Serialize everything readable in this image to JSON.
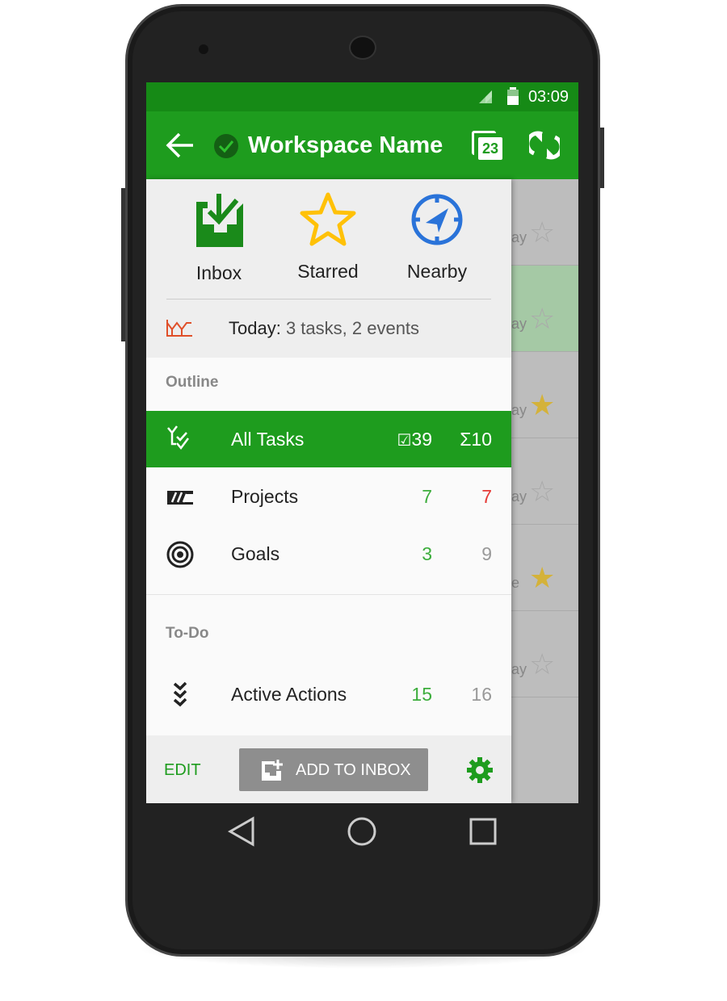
{
  "status_bar": {
    "time": "03:09"
  },
  "app_bar": {
    "title": "Workspace Name",
    "calendar_day": "23"
  },
  "quick_access": [
    {
      "label": "Inbox",
      "icon": "inbox-download-icon",
      "color": "#1a8a1a"
    },
    {
      "label": "Starred",
      "icon": "star-outline-icon",
      "color": "#ffc107"
    },
    {
      "label": "Nearby",
      "icon": "compass-icon",
      "color": "#2a73d9"
    }
  ],
  "today": {
    "label": "Today:",
    "summary": "3 tasks, 2 events"
  },
  "outline": {
    "header": "Outline",
    "items": [
      {
        "label": "All Tasks",
        "count1": "39",
        "count2": "10",
        "selected": true
      },
      {
        "label": "Projects",
        "count1": "7",
        "count2": "7"
      },
      {
        "label": "Goals",
        "count1": "3",
        "count2": "9"
      }
    ]
  },
  "todo": {
    "header": "To-Do",
    "items": [
      {
        "label": "Active Actions",
        "count1": "15",
        "count2": "16"
      }
    ]
  },
  "bottom": {
    "edit": "EDIT",
    "add_to_inbox": "ADD TO INBOX"
  },
  "background_list": [
    {
      "frag": "ay",
      "starred": false
    },
    {
      "frag": "ay",
      "starred": false
    },
    {
      "frag": "ay",
      "starred": true
    },
    {
      "frag": "ay",
      "starred": false
    },
    {
      "frag": "e",
      "starred": true
    },
    {
      "frag": "ay",
      "starred": false
    }
  ],
  "colors": {
    "primary": "#1e9c1e",
    "status": "#168a16",
    "green_count": "#3cad3c",
    "red_count": "#e53935",
    "star": "#d4b23a"
  }
}
